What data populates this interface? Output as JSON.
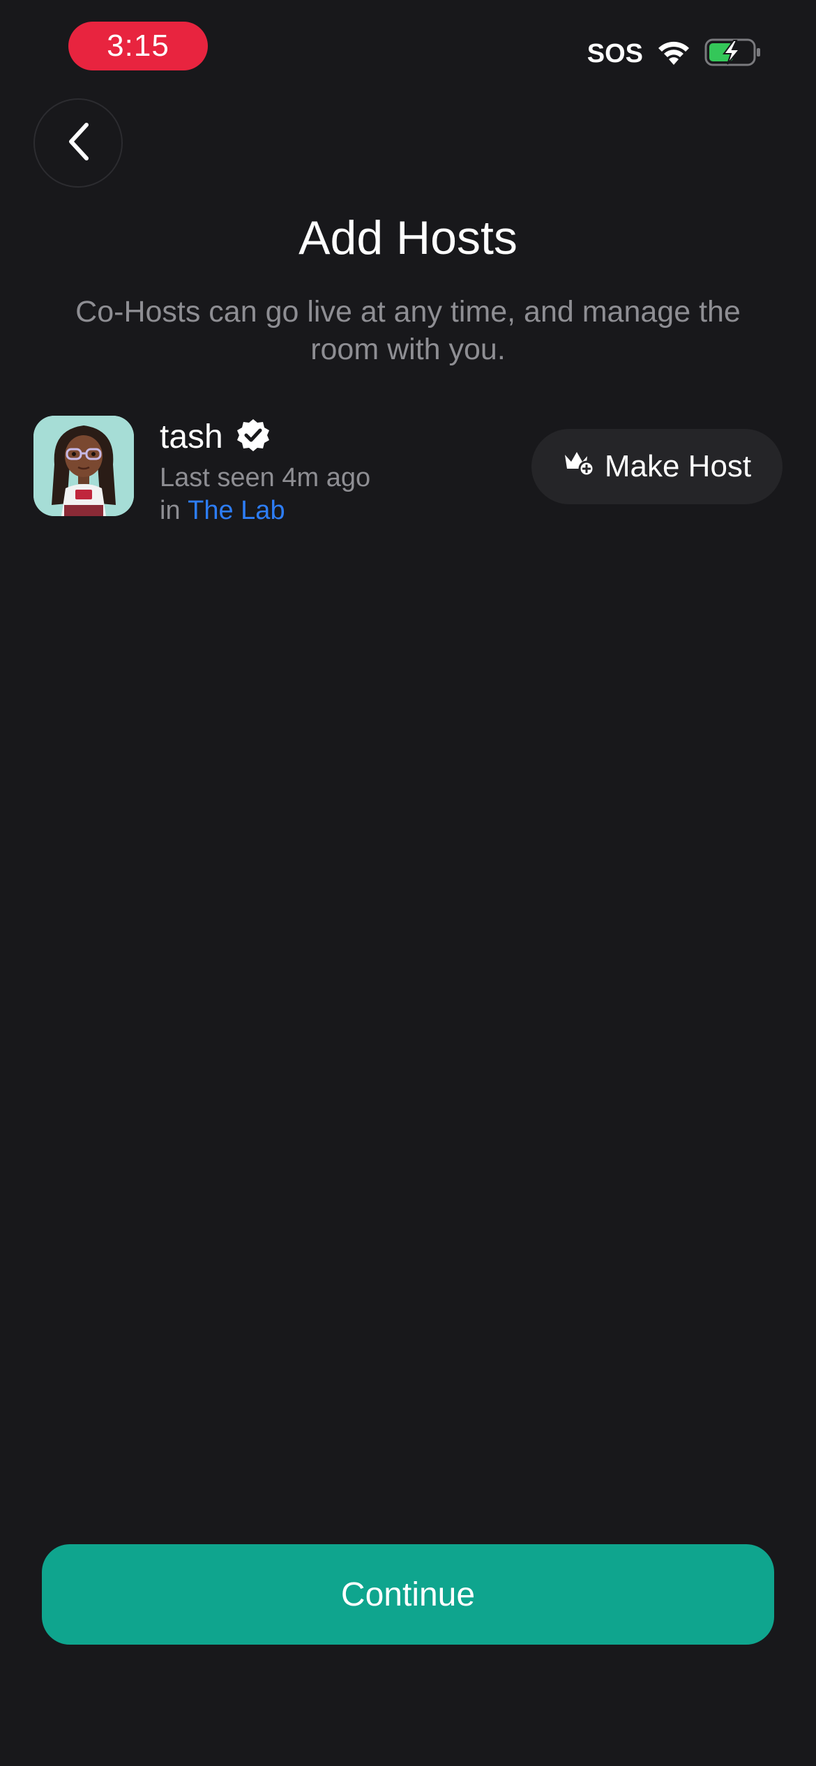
{
  "status_bar": {
    "time": "3:15",
    "carrier": "SOS",
    "wifi_icon": "wifi-icon",
    "battery_icon": "battery-charging-icon",
    "time_pill_color": "#e8243f",
    "battery_color": "#34c759"
  },
  "header": {
    "back_icon": "chevron-left-icon",
    "title": "Add Hosts",
    "subtitle": "Co-Hosts can go live at any time, and manage the room with you."
  },
  "users": [
    {
      "name": "tash",
      "verified_icon": "verified-badge-icon",
      "last_seen": "Last seen 4m ago",
      "in_prefix": "in",
      "room": "The Lab",
      "action_icon": "crown-add-icon",
      "action_label": "Make Host"
    }
  ],
  "footer": {
    "continue_label": "Continue",
    "accent_color": "#0fa58e",
    "link_color": "#2d7df6"
  }
}
